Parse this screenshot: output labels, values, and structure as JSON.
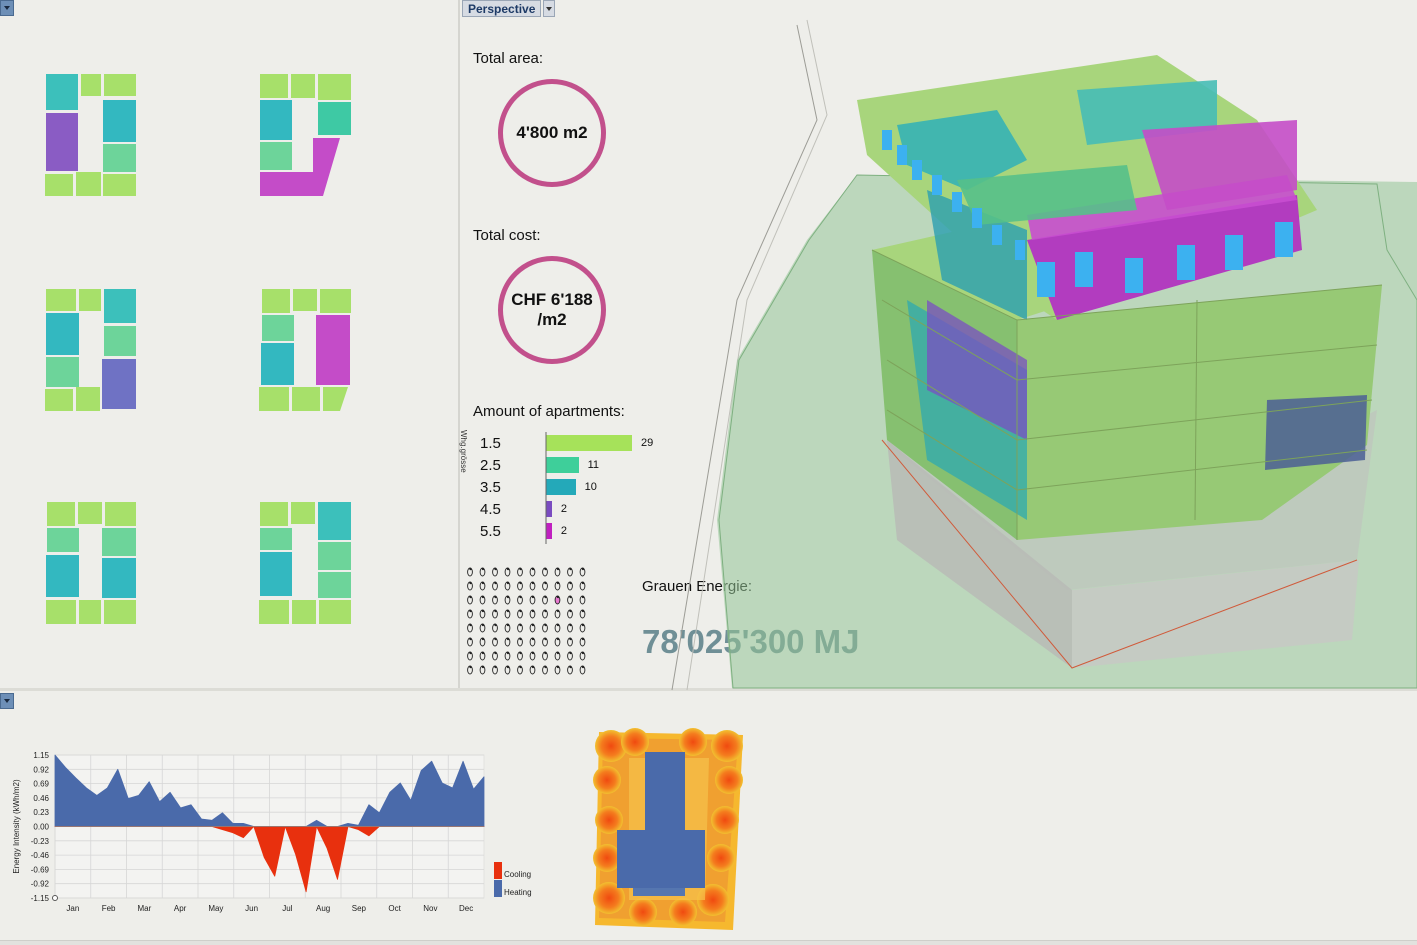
{
  "viewport": {
    "mode_label": "Perspective"
  },
  "metrics": {
    "total_area_label": "Total area:",
    "total_area_value": "4'800 m2",
    "total_cost_label": "Total cost:",
    "total_cost_value": "CHF 6'188\n/m2",
    "apartments_label": "Amount of apartments:",
    "apartments_axis_label": "Whg.grösse",
    "apartments": [
      {
        "size": "1.5",
        "count": 29,
        "color": "#a6e25a"
      },
      {
        "size": "2.5",
        "count": 11,
        "color": "#3ecf9a"
      },
      {
        "size": "3.5",
        "count": 10,
        "color": "#24a9b9"
      },
      {
        "size": "4.5",
        "count": 2,
        "color": "#7a4cc0"
      },
      {
        "size": "5.5",
        "count": 2,
        "color": "#c020c0"
      }
    ],
    "grey_energy_label": "Grauen Energie:",
    "grey_energy_value": "78'025'300 MJ"
  },
  "colors": {
    "ring": "#c2508c",
    "green": "#a7d86a",
    "teal": "#33b8b8",
    "mint": "#6dd49a",
    "purple": "#8a5cc4",
    "magenta": "#c44cc8",
    "blue_violet": "#6f72c4",
    "heating": "#4a6aaa",
    "cooling": "#e8300e"
  },
  "chart_data": {
    "type": "area",
    "ylabel": "Energy Intensity (kWh/m2)",
    "yticks": [
      "1.15",
      "0.92",
      "0.69",
      "0.46",
      "0.23",
      "0.00",
      "-0.23",
      "-0.46",
      "-0.69",
      "-0.92",
      "-1.15"
    ],
    "ylim": [
      -1.15,
      1.15
    ],
    "categories": [
      "Jan",
      "Feb",
      "Mar",
      "Apr",
      "May",
      "Jun",
      "Jul",
      "Aug",
      "Sep",
      "Oct",
      "Nov",
      "Dec"
    ],
    "series": [
      {
        "name": "Heating",
        "values": [
          1.15,
          0.95,
          0.78,
          0.62,
          0.5,
          0.62,
          0.92,
          0.45,
          0.5,
          0.72,
          0.4,
          0.55,
          0.3,
          0.35,
          0.12,
          0.1,
          0.22,
          0.05,
          0.05,
          0.0,
          0.0,
          0.0,
          0.0,
          0.0,
          0.0,
          0.1,
          0.0,
          0.0,
          0.05,
          0.02,
          0.35,
          0.22,
          0.55,
          0.7,
          0.42,
          0.9,
          1.05,
          0.7,
          0.62,
          1.05,
          0.6,
          0.8
        ]
      },
      {
        "name": "Cooling",
        "values": [
          0,
          0,
          0,
          0,
          0,
          0,
          0,
          0,
          0,
          0,
          0,
          0,
          0,
          0,
          0,
          0,
          -0.05,
          -0.1,
          -0.18,
          0,
          -0.5,
          -0.8,
          0,
          -0.45,
          -1.05,
          0,
          -0.35,
          -0.85,
          0,
          -0.05,
          -0.15,
          0,
          0,
          0,
          0,
          0,
          0,
          0,
          0,
          0,
          0,
          0
        ]
      }
    ],
    "legend": [
      {
        "label": "Cooling",
        "color": "#e8300e"
      },
      {
        "label": "Heating",
        "color": "#4a6aaa"
      }
    ],
    "legend_placement": "bottom-right",
    "grid": true
  }
}
